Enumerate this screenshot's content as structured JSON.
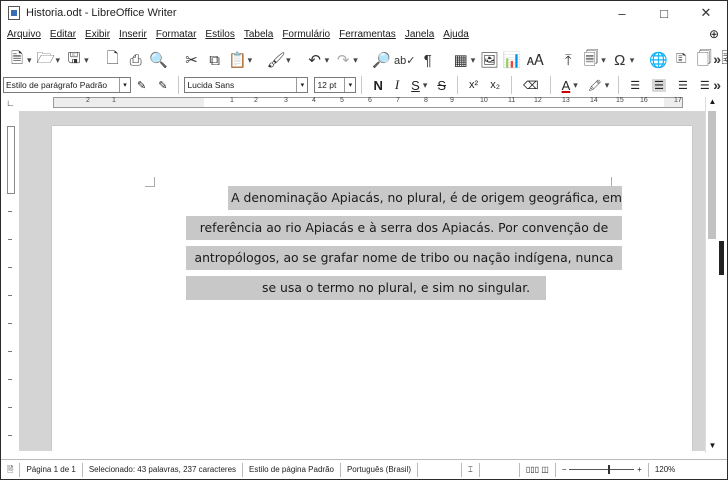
{
  "window": {
    "title": "Historia.odt - LibreOffice Writer",
    "minimize": "–",
    "maximize": "□",
    "close": "✕"
  },
  "menu": {
    "items": [
      "Arquivo",
      "Editar",
      "Exibir",
      "Inserir",
      "Formatar",
      "Estilos",
      "Tabela",
      "Formulário",
      "Ferramentas",
      "Janela",
      "Ajuda"
    ]
  },
  "formatting": {
    "paragraph_style": "Estilo de parágrafo Padrão",
    "font_name": "Lucida Sans",
    "font_size": "12 pt",
    "bold": "N",
    "italic": "I",
    "underline": "S",
    "strike": "S",
    "superscript": "x²",
    "subscript": "x₂"
  },
  "ruler": {
    "numbers": [
      "2",
      "1",
      "1",
      "2",
      "3",
      "4",
      "5",
      "6",
      "7",
      "8",
      "9",
      "10",
      "11",
      "12",
      "13",
      "14",
      "15",
      "16",
      "17"
    ]
  },
  "document": {
    "lines": [
      "A denominação Apiacás, no plural, é de origem geográfica, em",
      "referência ao rio Apiacás e à serra dos Apiacás. Por convenção de",
      "antropólogos, ao se grafar nome de tribo ou nação indígena, nunca",
      "se usa o termo no plural, e sim no singular."
    ]
  },
  "status": {
    "page": "Página 1 de 1",
    "selection": "Selecionado: 43 palavras, 237 caracteres",
    "page_style": "Estilo de página Padrão",
    "language": "Português (Brasil)",
    "zoom": "120%"
  }
}
